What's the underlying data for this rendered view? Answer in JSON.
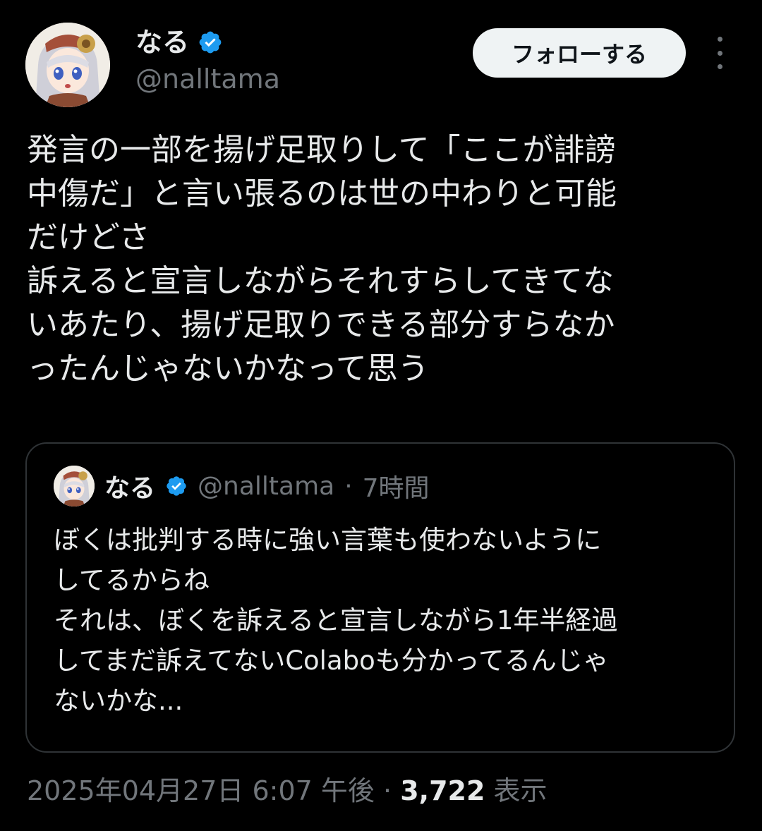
{
  "author": {
    "display_name": "なる",
    "handle": "@nalltama",
    "verified": true,
    "avatar_icon": "anime-girl-avatar-icon"
  },
  "actions": {
    "follow_label": "フォローする",
    "more_icon": "more-vertical-icon"
  },
  "tweet": {
    "text": "発言の一部を揚げ足取りして「ここが誹謗\n中傷だ」と言い張るのは世の中わりと可能\nだけどさ\n訴えると宣言しながらそれすらしてきてな\nいあたり、揚げ足取りできる部分すらなか\nったんじゃないかなって思う"
  },
  "quoted_tweet": {
    "display_name": "なる",
    "handle": "@nalltama",
    "separator": "·",
    "time": "7時間",
    "text": "ぼくは批判する時に強い言葉も使わないように\nしてるからね\nそれは、ぼくを訴えると宣言しながら1年半経過\nしてまだ訴えてないColaboも分かってるんじゃ\nないかな..."
  },
  "footer": {
    "timestamp": "2025年04月27日 6:07 午後",
    "separator": "·",
    "views_count": "3,722",
    "views_label": "表示"
  },
  "colors": {
    "background": "#000000",
    "text_primary": "#e7e9ea",
    "text_secondary": "#71767b",
    "verified_blue": "#1d9bf0",
    "border": "#2f3336",
    "follow_button_bg": "#eff3f4"
  }
}
